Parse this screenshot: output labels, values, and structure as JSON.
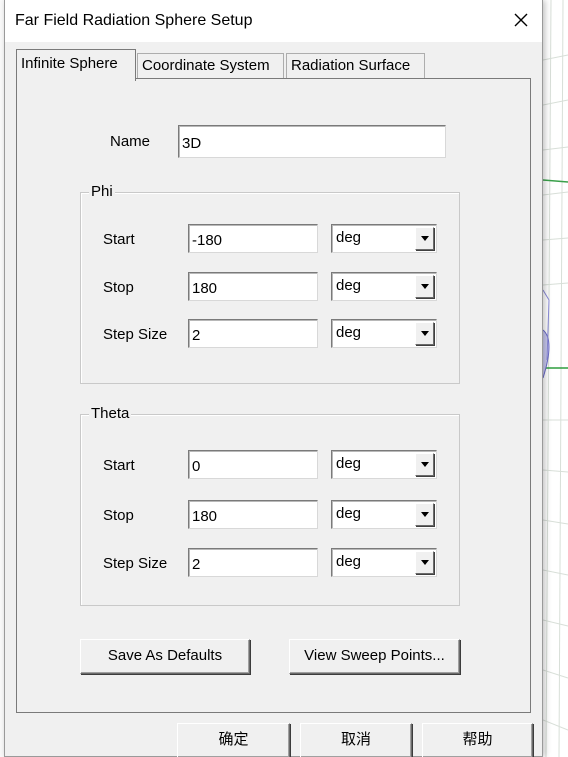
{
  "window": {
    "title": "Far Field Radiation Sphere Setup"
  },
  "tabs": [
    {
      "label": "Infinite Sphere",
      "active": true
    },
    {
      "label": "Coordinate System",
      "active": false
    },
    {
      "label": "Radiation Surface",
      "active": false
    }
  ],
  "form": {
    "name_label": "Name",
    "name_value": "3D",
    "phi": {
      "title": "Phi",
      "start_label": "Start",
      "start_value": "-180",
      "start_unit": "deg",
      "stop_label": "Stop",
      "stop_value": "180",
      "stop_unit": "deg",
      "step_label": "Step Size",
      "step_value": "2",
      "step_unit": "deg"
    },
    "theta": {
      "title": "Theta",
      "start_label": "Start",
      "start_value": "0",
      "start_unit": "deg",
      "stop_label": "Stop",
      "stop_value": "180",
      "stop_unit": "deg",
      "step_label": "Step Size",
      "step_value": "2",
      "step_unit": "deg"
    },
    "save_defaults_label": "Save As Defaults",
    "view_sweep_label": "View Sweep Points..."
  },
  "footer": {
    "ok_label": "确定",
    "cancel_label": "取消",
    "help_label": "帮助"
  },
  "icons": {
    "close": "close-icon",
    "dropdown": "chevron-down-icon"
  }
}
